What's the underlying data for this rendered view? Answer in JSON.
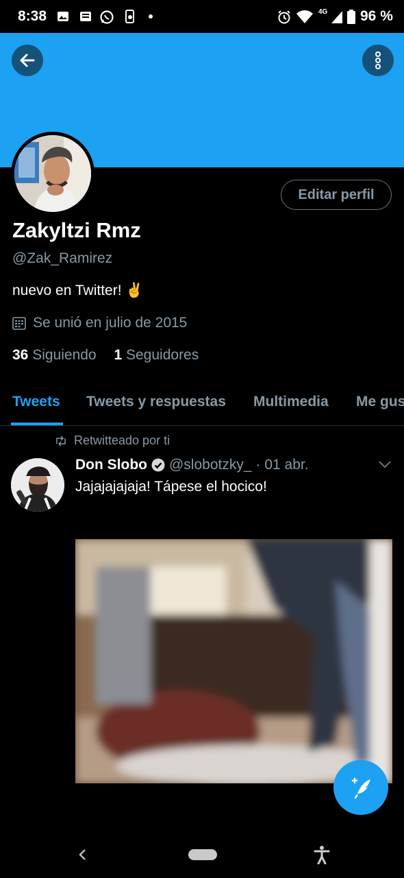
{
  "status_bar": {
    "time": "8:38",
    "battery": "96 %",
    "network": "4G",
    "left_icons": [
      "image-icon",
      "message-icon",
      "whatsapp-icon",
      "phone-sync-icon",
      "dot-icon"
    ],
    "right_icons": [
      "alarm-icon",
      "wifi-icon",
      "signal-icon",
      "battery-icon"
    ]
  },
  "header": {
    "back_icon": "arrow-left-icon",
    "more_icon": "more-vertical-icon",
    "banner_color": "#1da1f2"
  },
  "profile": {
    "edit_label": "Editar perfil",
    "name": "Zakyltzi Rmz",
    "handle": "@Zak_Ramirez",
    "bio": "nuevo en Twitter! ✌️",
    "joined": "Se unió en julio de 2015",
    "following_count": "36",
    "following_label": "Siguiendo",
    "followers_count": "1",
    "followers_label": "Seguidores"
  },
  "tabs": [
    {
      "label": "Tweets",
      "active": true
    },
    {
      "label": "Tweets y respuestas",
      "active": false
    },
    {
      "label": "Multimedia",
      "active": false
    },
    {
      "label": "Me gus",
      "active": false
    }
  ],
  "tweet": {
    "retweet_label": "Retwitteado por ti",
    "author": "Don Slobo",
    "handle": "@slobotzky_",
    "date": "· 01 abr.",
    "text": "Jajajajajaja! Tápese el hocico!",
    "verified": true
  },
  "fab": {
    "icon": "compose-tweet-icon"
  },
  "nav": {
    "icons": [
      "back-nav-icon",
      "home-pill-icon",
      "accessibility-icon"
    ]
  },
  "colors": {
    "accent": "#1da1f2",
    "muted": "#8899a6",
    "background": "#000000"
  }
}
